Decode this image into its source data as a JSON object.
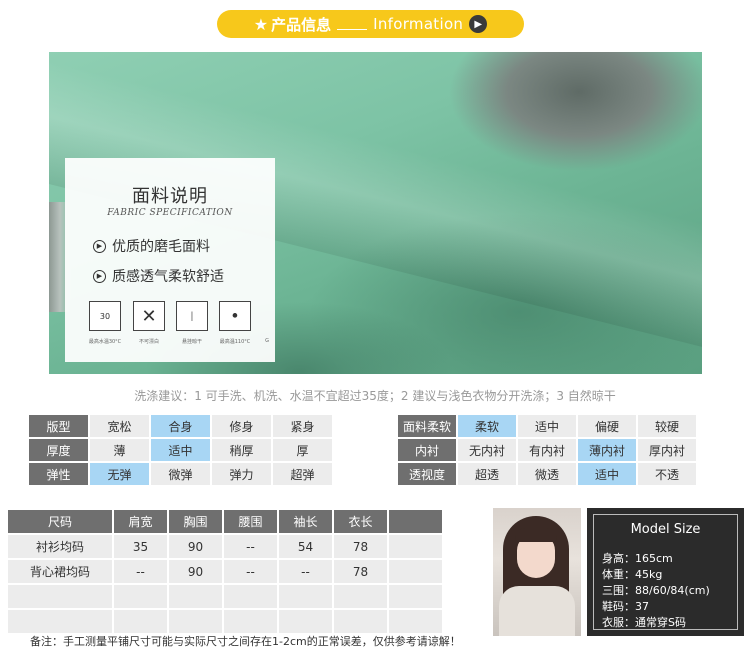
{
  "banner": {
    "title_cn": "产品信息",
    "title_en": "Information"
  },
  "fabric": {
    "title": "面料说明",
    "subtitle": "FABRIC SPECIFICATION",
    "features": [
      "优质的磨毛面料",
      "质感透气柔软舒适"
    ],
    "care_icons": [
      {
        "name": "wash-30-icon",
        "symbol": "30",
        "caption": "最高水温30°C"
      },
      {
        "name": "no-bleach-icon",
        "symbol": "✕",
        "caption": "不可漂白"
      },
      {
        "name": "hang-dry-icon",
        "symbol": "│",
        "caption": "悬挂晾干"
      },
      {
        "name": "iron-110-icon",
        "symbol": "⚫",
        "caption": "最高温110°C"
      }
    ],
    "logo": "G"
  },
  "wash_advice": "洗涤建议：1 可手洗、机洗、水温不宜超过35度；2 建议与浅色衣物分开洗涤；3 自然晾干",
  "fit_table": [
    {
      "header": "版型",
      "options": [
        "宽松",
        "合身",
        "修身",
        "紧身"
      ],
      "selected": 1
    },
    {
      "header": "厚度",
      "options": [
        "薄",
        "适中",
        "稍厚",
        "厚"
      ],
      "selected": 1
    },
    {
      "header": "弹性",
      "options": [
        "无弹",
        "微弹",
        "弹力",
        "超弹"
      ],
      "selected": 0
    }
  ],
  "fabric_table": [
    {
      "header": "面料柔软",
      "options": [
        "柔软",
        "适中",
        "偏硬",
        "较硬"
      ],
      "selected": 0
    },
    {
      "header": "内衬",
      "options": [
        "无内衬",
        "有内衬",
        "薄内衬",
        "厚内衬"
      ],
      "selected": 2
    },
    {
      "header": "透视度",
      "options": [
        "超透",
        "微透",
        "适中",
        "不透"
      ],
      "selected": 2
    }
  ],
  "size_table": {
    "headers": [
      "尺码",
      "肩宽",
      "胸围",
      "腰围",
      "袖长",
      "衣长",
      ""
    ],
    "rows": [
      [
        "衬衫均码",
        "35",
        "90",
        "--",
        "54",
        "78",
        ""
      ],
      [
        "背心裙均码",
        "--",
        "90",
        "--",
        "--",
        "78",
        ""
      ],
      [
        "",
        "",
        "",
        "",
        "",
        "",
        ""
      ],
      [
        "",
        "",
        "",
        "",
        "",
        "",
        ""
      ]
    ]
  },
  "note": "备注：手工测量平铺尺寸可能与实际尺寸之间存在1-2cm的正常误差，仅供参考请谅解！",
  "model": {
    "title": "Model Size",
    "rows": [
      "身高：165cm",
      "体重：45kg",
      "三围：88/60/84(cm)",
      "鞋码：37",
      "衣服：通常穿S码"
    ]
  },
  "colors": {
    "banner": "#f7c81b",
    "header_cell": "#6f6f6f",
    "selected_cell": "#a8d6f4",
    "cell": "#ececec"
  }
}
